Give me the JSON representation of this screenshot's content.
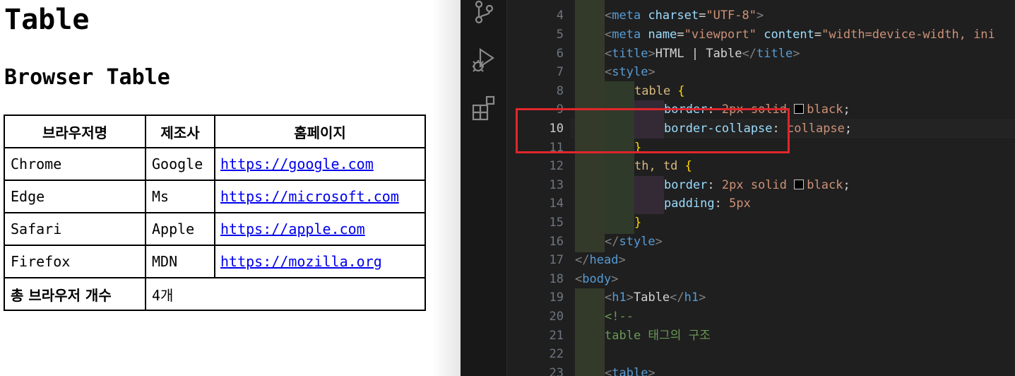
{
  "browser": {
    "heading": "Table",
    "subheading": "Browser Table",
    "table": {
      "headers": [
        "브라우저명",
        "제조사",
        "홈페이지"
      ],
      "rows": [
        {
          "name": "Chrome",
          "maker": "Google",
          "url": "https://google.com"
        },
        {
          "name": "Edge",
          "maker": "Ms",
          "url": "https://microsoft.com"
        },
        {
          "name": "Safari",
          "maker": "Apple",
          "url": "https://apple.com"
        },
        {
          "name": "Firefox",
          "maker": "MDN",
          "url": "https://mozilla.org"
        }
      ],
      "total_label": "총 브라우저 개수",
      "total_value": "4개"
    },
    "colors": {
      "link": "#0000ee",
      "border": "#000000"
    }
  },
  "editor": {
    "active_line": "10",
    "line_numbers": [
      "4",
      "5",
      "6",
      "7",
      "8",
      "9",
      "10",
      "11",
      "12",
      "13",
      "14",
      "15",
      "16",
      "17",
      "18",
      "19",
      "20",
      "21",
      "22",
      "23"
    ],
    "lines": {
      "l4": {
        "p1": "<",
        "t": "meta",
        "a1": " charset",
        "eq": "=",
        "s1": "\"UTF-8\"",
        "p2": ">"
      },
      "l5": {
        "p1": "<",
        "t": "meta",
        "a1": " name",
        "eq1": "=",
        "s1": "\"viewport\"",
        "a2": " content",
        "eq2": "=",
        "s2": "\"width=device-width, ini"
      },
      "l6": {
        "p1": "<",
        "t1": "title",
        "p2": ">",
        "text": "HTML | Table",
        "p3": "</",
        "t2": "title",
        "p4": ">"
      },
      "l7": {
        "p1": "<",
        "t": "style",
        "p2": ">"
      },
      "l8": {
        "sel": "table",
        "brace": " {"
      },
      "l9": {
        "prop": "border",
        "colon": ": ",
        "v1": "2px solid ",
        "v2": "black",
        "semi": ";"
      },
      "l10": {
        "prop": "border-collapse",
        "colon": ": ",
        "v": "collapse",
        "semi": ";"
      },
      "l11": {
        "brace": "}"
      },
      "l12": {
        "sel": "th, td",
        "brace": " {"
      },
      "l13": {
        "prop": "border",
        "colon": ": ",
        "v1": "2px solid ",
        "v2": "black",
        "semi": ";"
      },
      "l14": {
        "prop": "padding",
        "colon": ": ",
        "v": "5px"
      },
      "l15": {
        "brace": "}"
      },
      "l16": {
        "p1": "</",
        "t": "style",
        "p2": ">"
      },
      "l17": {
        "p1": "</",
        "t": "head",
        "p2": ">"
      },
      "l18": {
        "p1": "<",
        "t": "body",
        "p2": ">"
      },
      "l19": {
        "p1": "<",
        "t1": "h1",
        "p2": ">",
        "text": "Table",
        "p3": "</",
        "t2": "h1",
        "p4": ">"
      },
      "l20": {
        "c": "<!--"
      },
      "l21": {
        "c": "table 태그의 구조"
      },
      "l22": {},
      "l23": {
        "p1": "<",
        "t": "table",
        "p2": ">"
      }
    },
    "colors": {
      "background": "#1f1f1f",
      "tag": "#569cd6",
      "attribute": "#9cdcfe",
      "string": "#ce9178",
      "selector": "#d7ba7d",
      "brace": "#ffd700",
      "comment": "#6a9955",
      "highlight_box": "#e0262b"
    }
  },
  "activity_bar": {
    "icons": [
      "source-control-icon",
      "run-debug-icon",
      "extensions-icon"
    ]
  }
}
